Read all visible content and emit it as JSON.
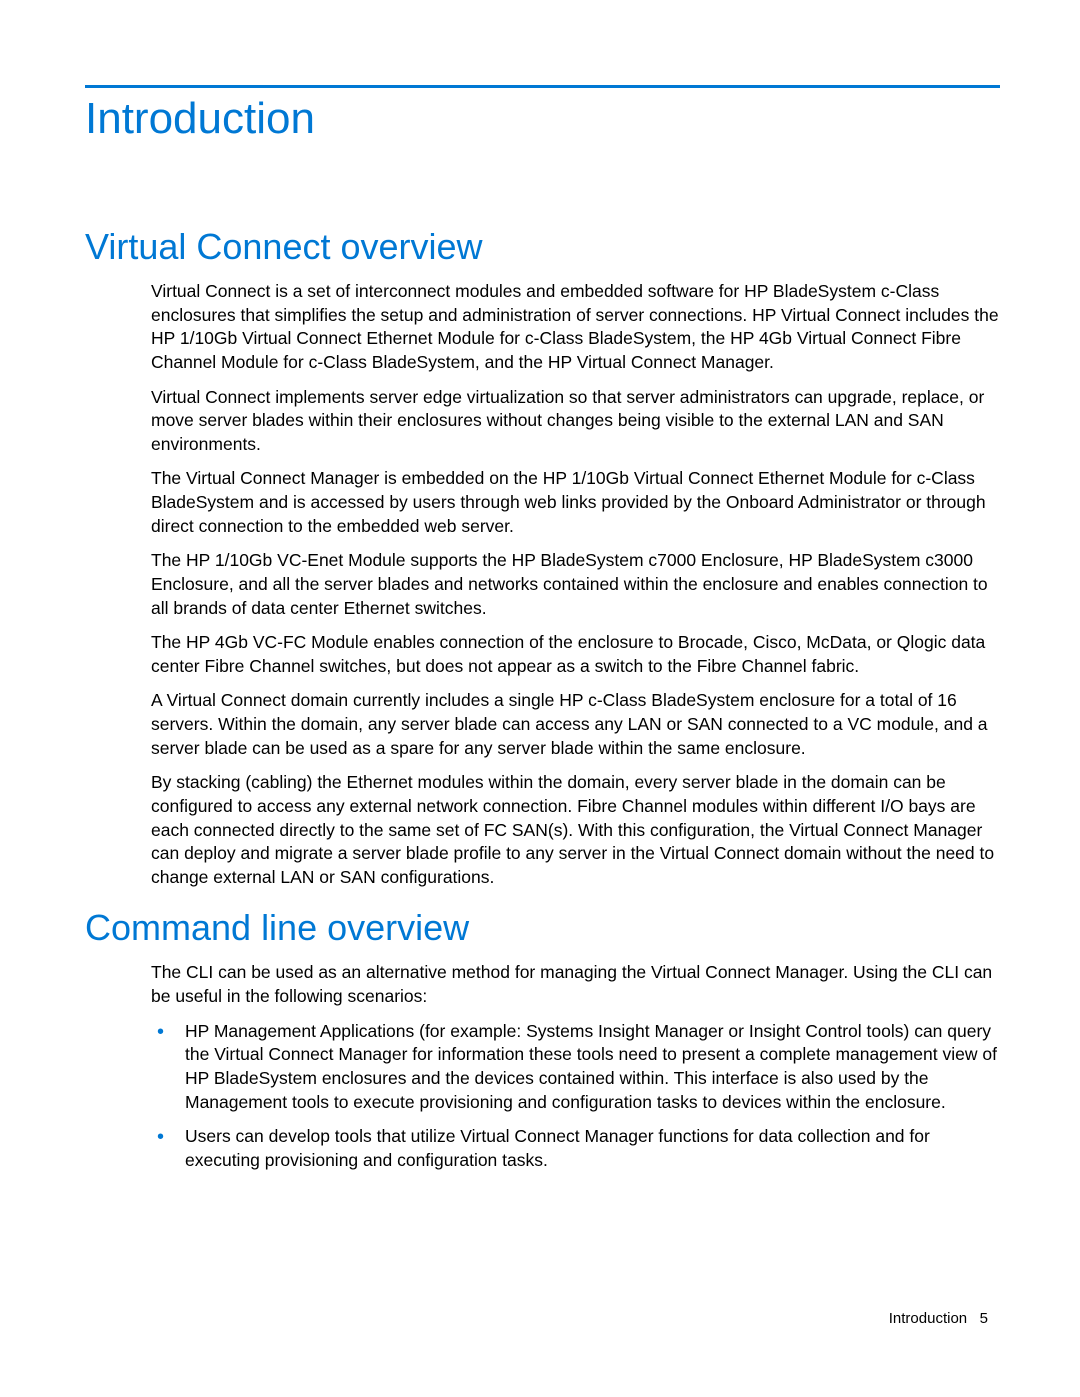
{
  "chapter": {
    "title": "Introduction"
  },
  "section1": {
    "title": "Virtual Connect overview",
    "paragraphs": [
      "Virtual Connect is a set of interconnect modules and embedded software for HP BladeSystem c-Class enclosures that simplifies the setup and administration of server connections. HP Virtual Connect includes the HP 1/10Gb Virtual Connect Ethernet Module for c-Class BladeSystem, the HP 4Gb Virtual Connect Fibre Channel Module for c-Class BladeSystem, and the HP Virtual Connect Manager.",
      "Virtual Connect implements server edge virtualization so that server administrators can upgrade, replace, or move server blades within their enclosures without changes being visible to the external LAN and SAN environments.",
      "The Virtual Connect Manager is embedded on the HP 1/10Gb Virtual Connect Ethernet Module for c-Class BladeSystem and is accessed by users through web links provided by the Onboard Administrator or through direct connection to the embedded web server.",
      "The HP 1/10Gb VC-Enet Module supports the HP BladeSystem c7000 Enclosure, HP BladeSystem c3000 Enclosure, and all the server blades and networks contained within the enclosure and enables connection to all brands of data center Ethernet switches.",
      "The HP 4Gb VC-FC Module enables connection of the enclosure to Brocade, Cisco, McData, or Qlogic data center Fibre Channel switches, but does not appear as a switch to the Fibre Channel fabric.",
      "A Virtual Connect domain currently includes a single HP c-Class BladeSystem enclosure for a total of 16 servers. Within the domain, any server blade can access any LAN or SAN connected to a VC module, and a server blade can be used as a spare for any server blade within the same enclosure.",
      "By stacking (cabling) the Ethernet modules within the domain, every server blade in the domain can be configured to access any external network connection. Fibre Channel modules within different I/O bays are each connected directly to the same set of FC SAN(s). With this configuration, the Virtual Connect Manager can deploy and migrate a server blade profile to any server in the Virtual Connect domain without the need to change external LAN or SAN configurations."
    ]
  },
  "section2": {
    "title": "Command line overview",
    "intro": "The CLI can be used as an alternative method for managing the Virtual Connect Manager. Using the CLI can be useful in the following scenarios:",
    "bullets": [
      "HP Management Applications (for example: Systems Insight Manager or Insight Control tools) can query the Virtual Connect Manager for information these tools need to present a complete management view of HP BladeSystem enclosures and the devices contained within. This interface is also used by the Management tools to execute provisioning and configuration tasks to devices within the enclosure.",
      "Users can develop tools that utilize Virtual Connect Manager functions for data collection and for executing provisioning and configuration tasks."
    ]
  },
  "footer": {
    "section": "Introduction",
    "page": "5"
  }
}
